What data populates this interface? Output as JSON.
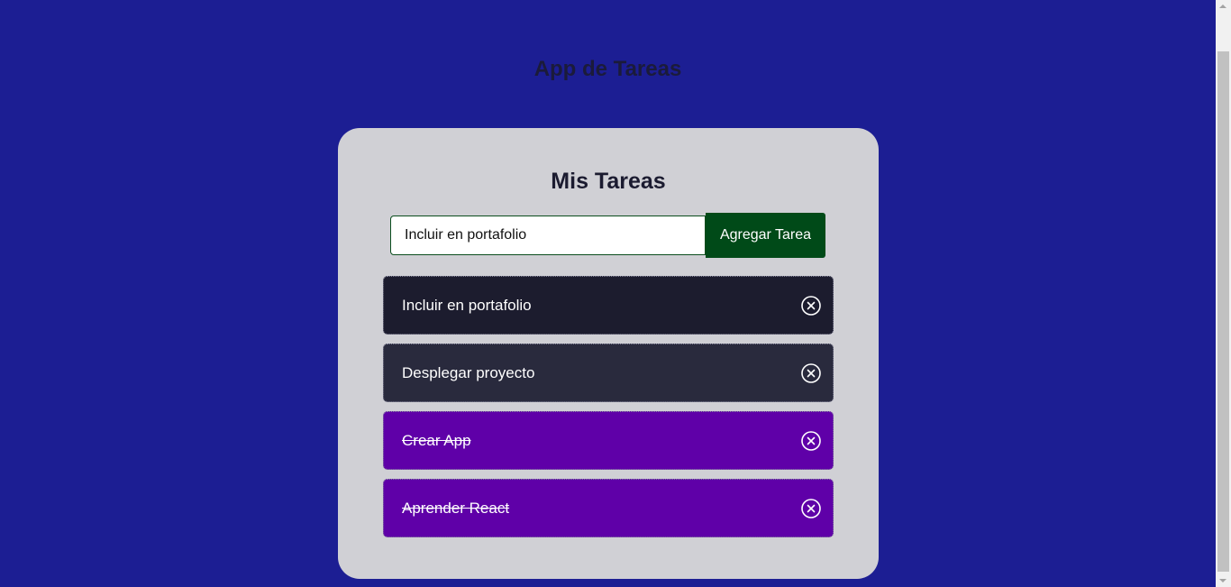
{
  "app": {
    "title": "App de Tareas"
  },
  "card": {
    "title": "Mis Tareas"
  },
  "form": {
    "input_value": "Incluir en portafolio",
    "button_label": "Agregar Tarea"
  },
  "tasks": [
    {
      "text": "Incluir en portafolio",
      "completed": false
    },
    {
      "text": "Desplegar proyecto",
      "completed": false
    },
    {
      "text": "Crear App",
      "completed": true
    },
    {
      "text": "Aprender React",
      "completed": true
    }
  ],
  "icons": {
    "delete": "close-circle-icon"
  },
  "colors": {
    "background": "#1c1e93",
    "card": "#d0d0d5",
    "button": "#004a18",
    "task_pending_1": "#1c1c2e",
    "task_pending_2": "#292a3d",
    "task_completed": "#5f00a8"
  }
}
